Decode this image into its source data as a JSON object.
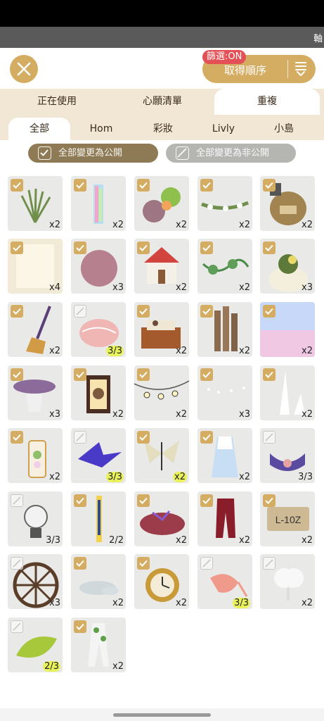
{
  "top_strip": {
    "trunc_text": "軸"
  },
  "header": {
    "sort_label": "取得順序",
    "filter_badge": "篩選:ON"
  },
  "tabs": [
    {
      "label": "正在使用",
      "active": false
    },
    {
      "label": "心願清單",
      "active": false
    },
    {
      "label": "重複",
      "active": true
    }
  ],
  "subtabs": [
    {
      "label": "全部",
      "active": true
    },
    {
      "label": "Hom",
      "active": false
    },
    {
      "label": "彩妝",
      "active": false
    },
    {
      "label": "Livly",
      "active": false
    },
    {
      "label": "小島",
      "active": false
    }
  ],
  "actions": {
    "make_public": "全部變更為公開",
    "make_private": "全部變更為非公開"
  },
  "items": [
    {
      "name": "grass",
      "count": "x2",
      "checked": true,
      "highlight": false
    },
    {
      "name": "crystal-pillar",
      "count": "x2",
      "checked": true,
      "highlight": false
    },
    {
      "name": "flower-bush",
      "count": "x2",
      "checked": true,
      "highlight": false
    },
    {
      "name": "flower-garland",
      "count": "x2",
      "checked": true,
      "highlight": false
    },
    {
      "name": "seed-sack",
      "count": "x2",
      "checked": true,
      "highlight": false
    },
    {
      "name": "window-light",
      "count": "x4",
      "checked": true,
      "highlight": false
    },
    {
      "name": "pink-fluff",
      "count": "x3",
      "checked": true,
      "highlight": false
    },
    {
      "name": "red-roof-house",
      "count": "x2",
      "checked": true,
      "highlight": false
    },
    {
      "name": "green-vine",
      "count": "x2",
      "checked": true,
      "highlight": false
    },
    {
      "name": "plant-pot",
      "count": "x3",
      "checked": true,
      "highlight": false
    },
    {
      "name": "broom",
      "count": "x2",
      "checked": true,
      "highlight": false
    },
    {
      "name": "pink-shell",
      "count": "3/3",
      "checked": false,
      "highlight": true
    },
    {
      "name": "wood-crate",
      "count": "x2",
      "checked": true,
      "highlight": false
    },
    {
      "name": "bamboo-posts",
      "count": "x2",
      "checked": true,
      "highlight": false
    },
    {
      "name": "pastel-sky",
      "count": "x2",
      "checked": true,
      "highlight": false
    },
    {
      "name": "flower-table",
      "count": "x3",
      "checked": true,
      "highlight": false
    },
    {
      "name": "lantern",
      "count": "x2",
      "checked": true,
      "highlight": false
    },
    {
      "name": "lantern-string",
      "count": "x2",
      "checked": true,
      "highlight": false
    },
    {
      "name": "dot-string",
      "count": "x3",
      "checked": true,
      "highlight": false
    },
    {
      "name": "white-spikes",
      "count": "x2",
      "checked": true,
      "highlight": false
    },
    {
      "name": "pressed-flower",
      "count": "x2",
      "checked": true,
      "highlight": false
    },
    {
      "name": "paper-crane",
      "count": "3/3",
      "checked": false,
      "highlight": true
    },
    {
      "name": "paper-butterfly",
      "count": "x2",
      "checked": true,
      "highlight": true
    },
    {
      "name": "gradient-dress",
      "count": "x2",
      "checked": true,
      "highlight": false
    },
    {
      "name": "purple-bow",
      "count": "3/3",
      "checked": false,
      "highlight": false
    },
    {
      "name": "lightbulb",
      "count": "3/3",
      "checked": false,
      "highlight": false
    },
    {
      "name": "banner-stick",
      "count": "2/2",
      "checked": true,
      "highlight": false
    },
    {
      "name": "fish-pond",
      "count": "x2",
      "checked": true,
      "highlight": false
    },
    {
      "name": "red-pants",
      "count": "x2",
      "checked": true,
      "highlight": false
    },
    {
      "name": "license-plate",
      "count": "x2",
      "checked": true,
      "highlight": false
    },
    {
      "name": "cart-wheel",
      "count": "x3",
      "checked": false,
      "highlight": false
    },
    {
      "name": "water-puddle",
      "count": "x2",
      "checked": true,
      "highlight": false
    },
    {
      "name": "vine-clock",
      "count": "x2",
      "checked": true,
      "highlight": false
    },
    {
      "name": "shrimp",
      "count": "3/3",
      "checked": false,
      "highlight": true
    },
    {
      "name": "cloud-lamp",
      "count": "x2",
      "checked": false,
      "highlight": false
    },
    {
      "name": "green-leaf",
      "count": "2/3",
      "checked": false,
      "highlight": true
    },
    {
      "name": "leafy-suit",
      "count": "x2",
      "checked": true,
      "highlight": false
    }
  ],
  "colors": {
    "accent_gold": "#d4ad62",
    "tab_bg": "#f1e7d4",
    "badge_red": "#e35056",
    "pill_dark": "#8e7b55",
    "pill_light": "#b5b5b2",
    "count_highlight": "#e9f25a",
    "cell_bg": "#e9e9e7"
  },
  "icons": {
    "close": "close-x-icon",
    "sort": "sort-lines-icon",
    "check": "checkmark-icon"
  }
}
